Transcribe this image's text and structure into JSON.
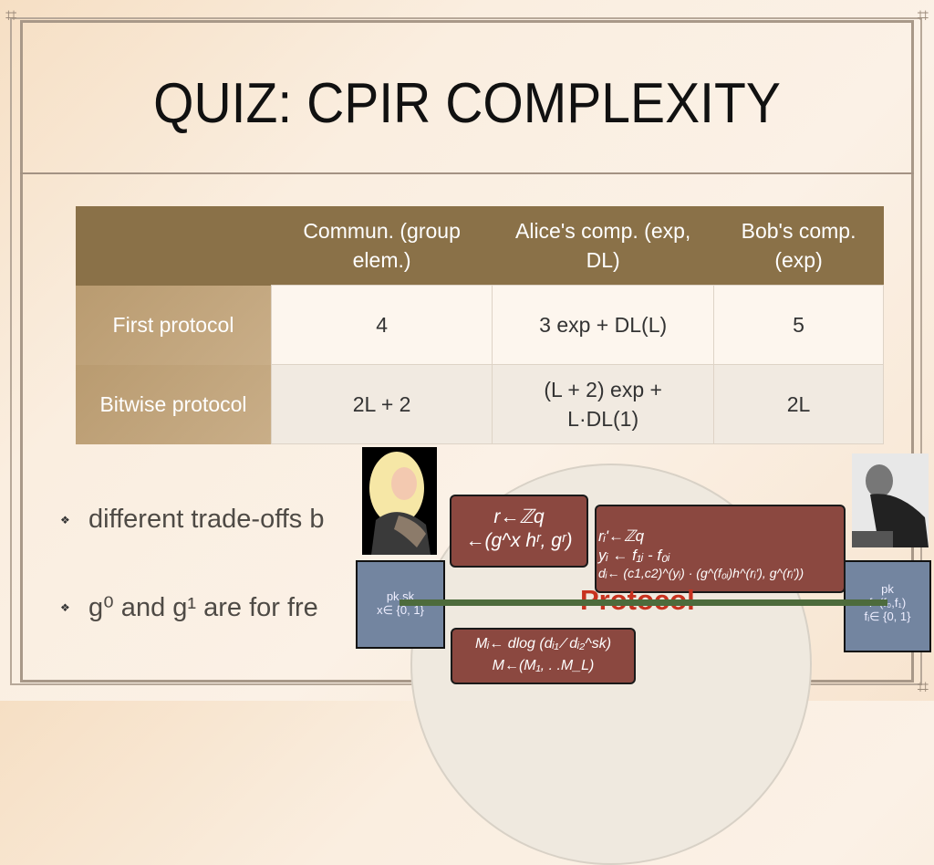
{
  "slide": {
    "title": "QUIZ: CPIR COMPLEXITY"
  },
  "table": {
    "headers": [
      "",
      "Commun. (group elem.)",
      "Alice's comp. (exp, DL)",
      "Bob's comp. (exp)"
    ],
    "rows": [
      {
        "label": "First protocol",
        "commun": "4",
        "alice": "3 exp + DL(L)",
        "bob": "5"
      },
      {
        "label": "Bitwise protocol",
        "commun": "2L + 2",
        "alice": "(L + 2) exp + L·DL(1)",
        "bob": "2L"
      }
    ]
  },
  "bullets": [
    {
      "text": "different trade-offs b",
      "icon": "diamond-bullet-icon"
    },
    {
      "text": "g⁰ and g¹ are for fre",
      "icon": "diamond-bullet-icon"
    }
  ],
  "diagram": {
    "alice_box": {
      "line1": "pk,sk",
      "line2": "x∈ {0, 1}"
    },
    "bob_box": {
      "line1": "pk",
      "line2": "f=(f₀,f₁)",
      "line3": "fᵢ∈ {0, 1}"
    },
    "alice_bubble": {
      "line1": "r←ℤq",
      "line2": "←(g^x hʳ, gʳ)"
    },
    "bob_bubble": {
      "line1": "rᵢ'←ℤq",
      "line2": "yᵢ ← f₁ᵢ - f₀ᵢ",
      "line3": "dᵢ← (c1,c2)^(yᵢ) · (g^(f₀ᵢ)h^(rᵢ'), g^(rᵢ'))"
    },
    "decode_bubble": {
      "line1": "Mᵢ← dlog (dᵢ₁ ⁄ dᵢ₂^sk)",
      "line2": "M←(M₁, . .M_L)"
    },
    "protocol_label": "Protocol",
    "colors": {
      "bubble": "#8b4840",
      "box": "#7385a0",
      "arrow": "#4d6b3c",
      "protocol": "#c8321f"
    }
  }
}
